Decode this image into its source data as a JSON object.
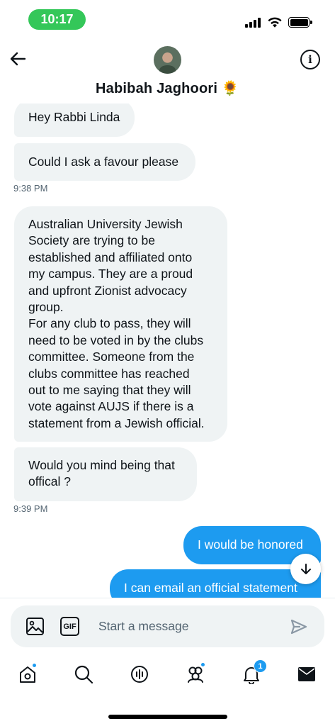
{
  "status_bar": {
    "time": "10:17"
  },
  "header": {
    "contact_name": "Habibah Jaghoori 🌻"
  },
  "messages": [
    {
      "text": "Hey Rabbi Linda"
    },
    {
      "text": "Could I ask a favour please"
    },
    {
      "timestamp": "9:38 PM"
    },
    {
      "lines": [
        "Australian University Jewish",
        "Society are trying to be",
        "established and affiliated onto",
        "my campus. They are a proud",
        "and upfront Zionist advocacy",
        "group.",
        "For any club to pass, they will",
        "need to be voted in by the clubs",
        "committee. Someone from the",
        "clubs committee has reached",
        "out to me saying that they will",
        "vote against AUJS if there is a",
        "statement from a Jewish official."
      ]
    },
    {
      "lines": [
        "Would you mind being that",
        "offical ?"
      ]
    },
    {
      "timestamp": "9:39 PM"
    },
    {
      "text": "I would be honored"
    },
    {
      "text": "I can email an official statement"
    }
  ],
  "composer": {
    "placeholder": "Start a message",
    "gif_label": "GIF"
  },
  "tab_bar": {
    "notifications_count": "1"
  },
  "icons": {
    "back": "back-arrow-icon",
    "info": "info-icon",
    "scroll": "arrow-down-icon",
    "image": "image-icon",
    "gif": "gif-icon",
    "send": "send-icon",
    "home": "home-icon",
    "search": "search-icon",
    "spaces": "spaces-icon",
    "communities": "communities-icon",
    "notifications": "bell-icon",
    "messages": "envelope-icon"
  },
  "colors": {
    "accent": "#1d9bf0",
    "received_bubble": "#eff3f4",
    "status_pill": "#34c759"
  }
}
